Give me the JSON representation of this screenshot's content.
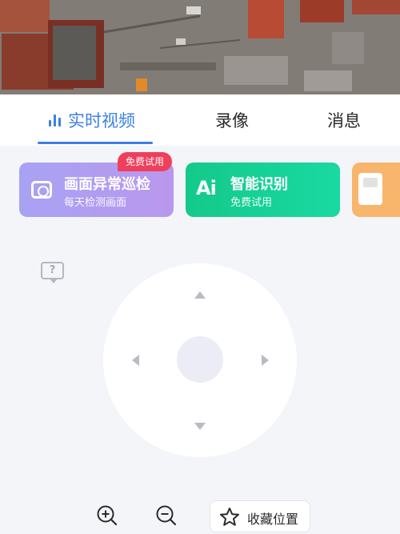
{
  "tabs": [
    {
      "label": "实时视频",
      "active": true
    },
    {
      "label": "录像",
      "active": false
    },
    {
      "label": "消息",
      "active": false
    }
  ],
  "cards": {
    "patrol": {
      "badge": "免费试用",
      "title": "画面异常巡检",
      "subtitle": "每天检测画面"
    },
    "ai": {
      "icon_text": "Ai",
      "title": "智能识别",
      "subtitle": "免费试用"
    }
  },
  "controls": {
    "help_icon": "?",
    "favorite_label": "收藏位置"
  },
  "colors": {
    "accent": "#3d7fe6",
    "badge": "#ef3f5b",
    "patrol_card": "#b09cf1",
    "ai_card": "#17d196",
    "third_card": "#f8b56c"
  },
  "icons": [
    "chart-bars-icon",
    "camera-patrol-icon",
    "ai-icon",
    "help-icon",
    "zoom-in-icon",
    "zoom-out-icon",
    "star-icon"
  ]
}
